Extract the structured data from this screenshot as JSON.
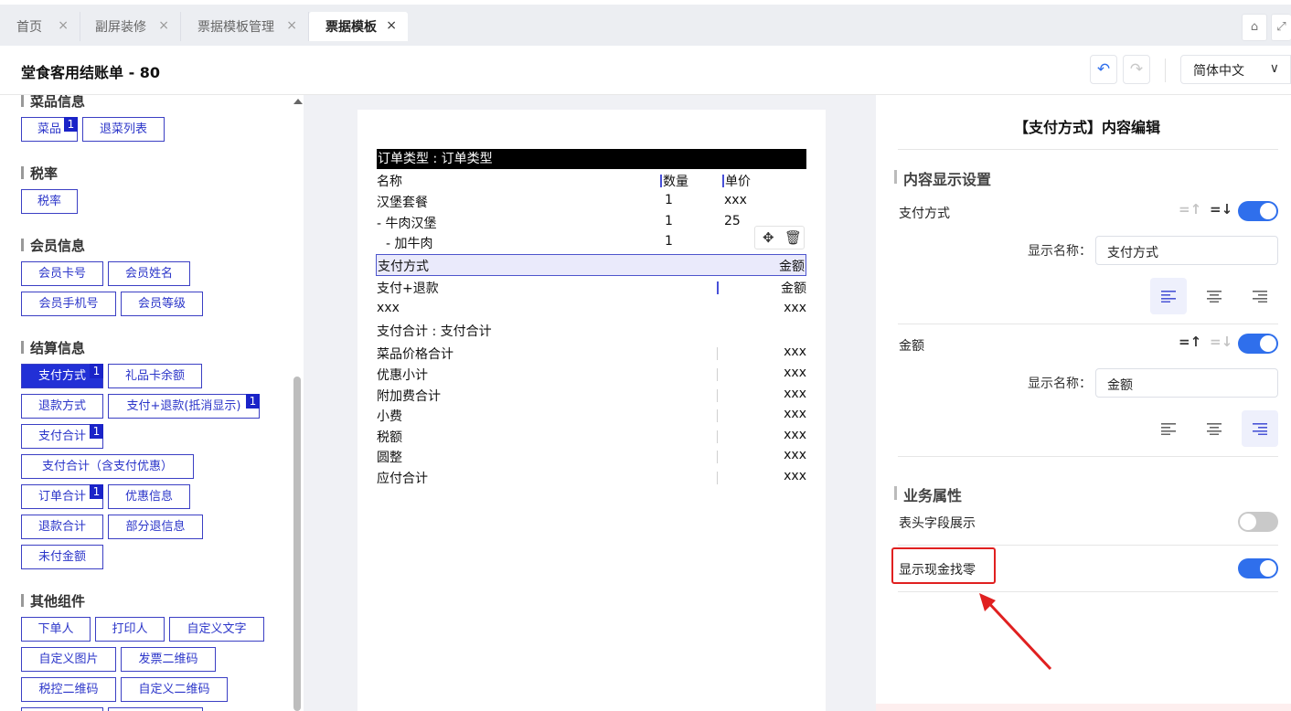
{
  "tabs": [
    {
      "label": "首页"
    },
    {
      "label": "副屏装修"
    },
    {
      "label": "票据模板管理"
    },
    {
      "label": "票据模板"
    }
  ],
  "tab_close": "×",
  "header": {
    "title": "堂食客用结账单 - 80",
    "language": "简体中文"
  },
  "left_panel": {
    "sections": [
      {
        "title": "菜品信息",
        "items": [
          "菜品",
          "退菜列表"
        ]
      },
      {
        "title": "税率",
        "items": [
          "税率"
        ]
      },
      {
        "title": "会员信息",
        "items": [
          "会员卡号",
          "会员姓名",
          "会员手机号",
          "会员等级"
        ]
      },
      {
        "title": "结算信息",
        "items": [
          "支付方式",
          "礼品卡余额",
          "退款方式",
          "支付+退款(抵消显示)",
          "支付合计",
          "支付合计（含支付优惠）",
          "订单合计",
          "优惠信息",
          "退款合计",
          "部分退信息",
          "未付金额"
        ]
      },
      {
        "title": "其他组件",
        "items": [
          "下单人",
          "打印人",
          "自定义文字",
          "自定义图片",
          "发票二维码",
          "税控二维码",
          "自定义二维码"
        ]
      }
    ],
    "badge": "1"
  },
  "receipt": {
    "order_type": "订单类型 : 订单类型",
    "col_name": "名称",
    "col_qty": "数量",
    "col_price": "单价",
    "items": [
      {
        "name": "汉堡套餐",
        "qty": "1",
        "price": "xxx"
      },
      {
        "name": "- 牛肉汉堡",
        "qty": "1",
        "price": "25"
      },
      {
        "name": "- 加牛肉",
        "qty": "1",
        "price": ""
      }
    ],
    "pay_method": "支付方式",
    "amount": "金额",
    "pay_refund": "支付+退款",
    "pay_refund_amount": "金额",
    "xxx_label": "xxx",
    "xxx_value": "xxx",
    "pay_total": "支付合计 : 支付合计",
    "summary": [
      {
        "label": "菜品价格合计",
        "value": "xxx"
      },
      {
        "label": "优惠小计",
        "value": "xxx"
      },
      {
        "label": "附加费合计",
        "value": "xxx"
      },
      {
        "label": "小费",
        "value": "xxx"
      },
      {
        "label": "税额",
        "value": "xxx"
      },
      {
        "label": "圆整",
        "value": "xxx"
      },
      {
        "label": "应付合计",
        "value": "xxx"
      }
    ]
  },
  "right_panel": {
    "title": "【支付方式】内容编辑",
    "display_section": "内容显示设置",
    "fields": [
      {
        "label": "支付方式",
        "display_name_label": "显示名称：",
        "display_name": "支付方式",
        "enabled": true,
        "alignment": "left"
      },
      {
        "label": "金额",
        "display_name_label": "显示名称：",
        "display_name": "金额",
        "enabled": true,
        "alignment": "right"
      }
    ],
    "business_section": "业务属性",
    "props": [
      {
        "label": "表头字段展示",
        "enabled": false
      },
      {
        "label": "显示现金找零",
        "enabled": true
      }
    ]
  },
  "colors": {
    "accent": "#2f6fec",
    "chip": "#2b35c9",
    "chip_selected": "#2230d6",
    "highlight": "#e02020"
  }
}
